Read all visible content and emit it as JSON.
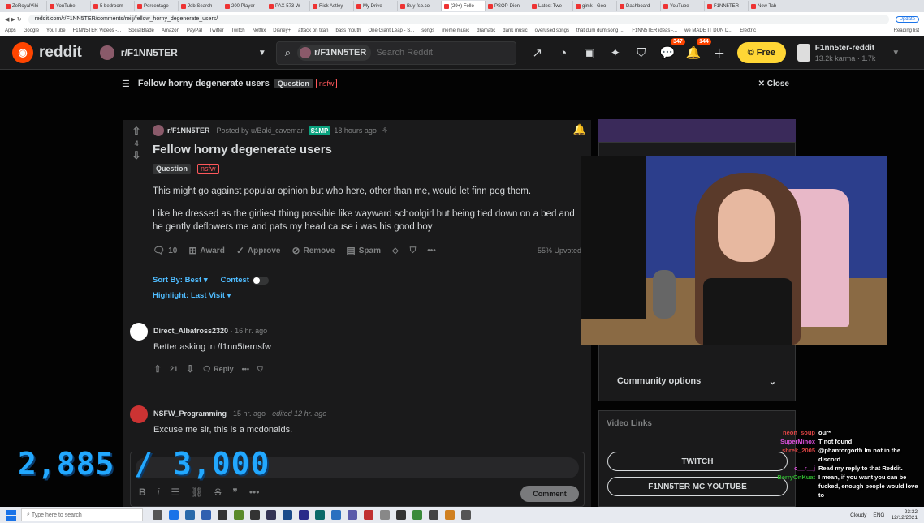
{
  "browser": {
    "tabs": [
      "ZeRoyalViki",
      "YouTube",
      "5 bedroom",
      "Percentage",
      "Job Search",
      "200 Player",
      "PAX 573 W",
      "Rick Astley",
      "My Drive",
      "Buy fsb.co",
      "(29+) Fello",
      "PSOP-Dion",
      "Latest Twe",
      "gimk - Goo",
      "Dashboard",
      "YouTube",
      "F1NN5TER",
      "New Tab"
    ],
    "url": "reddit.com/r/F1NN5TER/comments/reilj/fellow_horny_degenerate_users/",
    "update_label": "Update",
    "bookmarks": [
      "Apps",
      "Google",
      "YouTube",
      "F1NN5TER Videos -...",
      "SocialBlade",
      "Amazon",
      "PayPal",
      "Twitter",
      "Twitch",
      "Netflix",
      "Disney+",
      "attack on titan",
      "bass mouth",
      "One Giant Leap - S...",
      "songs",
      "meme music",
      "dramatic",
      "dank music",
      "overused songs",
      "that dum dum song i...",
      "F1NN5TER ideas -...",
      "we MADE IT DUN D...",
      "Electric"
    ],
    "reading_list": "Reading list"
  },
  "header": {
    "logo_text": "reddit",
    "subreddit": "r/F1NN5TER",
    "search_chip": "r/F1NN5TER",
    "search_placeholder": "Search Reddit",
    "chat_badge": "347",
    "notif_badge": "144",
    "free_label": "Free",
    "username": "F1nn5ter-reddit",
    "karma": "13.2k karma",
    "coins": "1.7k"
  },
  "post_bar": {
    "title": "Fellow horny degenerate users",
    "flair": "Question",
    "nsfw": "nsfw",
    "close": "Close"
  },
  "post": {
    "score": "4",
    "subreddit": "r/F1NN5TER",
    "posted_by": "· Posted by u/Baki_caveman",
    "user_flair": "S1MP",
    "time": "18 hours ago",
    "title": "Fellow horny degenerate users",
    "flair": "Question",
    "nsfw": "nsfw",
    "body_1": "This might go against popular opinion but who here, other than me, would let finn peg them.",
    "body_2": "Like he dressed as the girliest thing possible like wayward schoolgirl but being tied down on a bed and he gently deflowers me and pats my head cause i was his good boy",
    "comments_count": "10",
    "award": "Award",
    "approve": "Approve",
    "remove": "Remove",
    "spam": "Spam",
    "upvoted": "55% Upvoted"
  },
  "sort": {
    "sort_by": "Sort By: Best",
    "contest": "Contest",
    "highlight": "Highlight: Last Visit"
  },
  "comments": [
    {
      "user": "Direct_Albatross2320",
      "time": "· 16 hr. ago",
      "edited": "",
      "body": "Better asking in /f1nn5ternsfw",
      "score": "21",
      "reply": "Reply"
    },
    {
      "user": "NSFW_Programming",
      "time": "· 15 hr. ago ·",
      "edited": "edited 12 hr. ago",
      "body": "Excuse me sir, this is a mcdonalds."
    }
  ],
  "editor": {
    "comment_btn": "Comment"
  },
  "sidebar": {
    "community_options": "Community options",
    "video_links_title": "Video Links",
    "video_links": [
      "TWITCH",
      "F1NN5TER MC YOUTUBE"
    ]
  },
  "overlay": {
    "counter": "2,885 / 3,000"
  },
  "chat": [
    {
      "user": "neon_soup",
      "msg": "our*",
      "color": "#d44"
    },
    {
      "user": "SuperMinox",
      "msg": "T not found",
      "color": "#e052e0"
    },
    {
      "user": "shrek_2005",
      "msg": "@phantorgorth Im not in the discord",
      "color": "#d44"
    },
    {
      "user": "c__r__j",
      "msg": "Read my reply to that Reddit.",
      "color": "#e052e0"
    },
    {
      "user": "BerryOnKuat",
      "msg": "I mean, if you want you can be fucked, enough people would love to",
      "color": "#2fb22f"
    }
  ],
  "taskbar": {
    "search_placeholder": "Type here to search",
    "time": "23:32",
    "date": "12/12/2021",
    "weather": "Cloudy",
    "lang": "ENG"
  },
  "colors": {
    "accent": "#ff4500",
    "link": "#4fbcff",
    "counter": "#22a8ff"
  }
}
